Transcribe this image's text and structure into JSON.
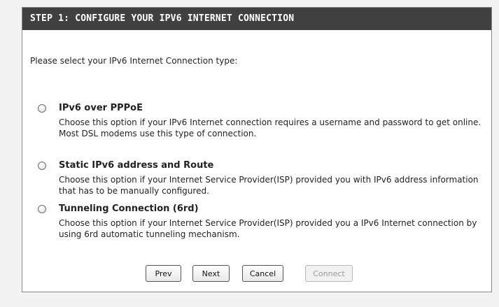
{
  "header": {
    "title": "STEP 1: CONFIGURE YOUR IPV6 INTERNET CONNECTION"
  },
  "intro": "Please select your IPv6 Internet Connection type:",
  "options": [
    {
      "title": "IPv6 over PPPoE",
      "description": "Choose this option if your IPv6 Internet connection requires a username and password to get online. Most DSL modems use this type of connection.",
      "selected": false
    },
    {
      "title": "Static IPv6 address and Route",
      "description": "Choose this option if your Internet Service Provider(ISP) provided you with IPv6 address information that has to be manually configured.",
      "selected": false
    },
    {
      "title": "Tunneling Connection (6rd)",
      "description": "Choose this option if your Internet Service Provider(ISP) provided you a IPv6 Internet connection by using 6rd automatic tunneling mechanism.",
      "selected": false
    }
  ],
  "buttons": {
    "prev": "Prev",
    "next": "Next",
    "cancel": "Cancel",
    "connect": "Connect"
  },
  "colors": {
    "header_bg": "#404040",
    "header_text": "#ffffff",
    "page_bg": "#f2f2f2"
  }
}
